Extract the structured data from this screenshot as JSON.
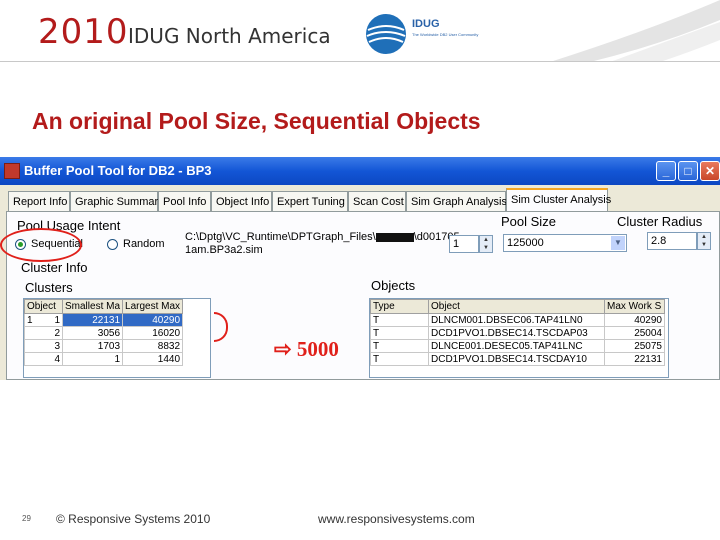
{
  "header": {
    "year": "2010",
    "conference": "IDUG North America",
    "logo_text": "IDUG",
    "logo_tagline": "The Worldwide DB2 User Community"
  },
  "slide_title": "An original Pool Size, Sequential Objects",
  "window": {
    "title": "Buffer Pool Tool for DB2 - BP3",
    "buttons": {
      "minimize": "_",
      "maximize": "□",
      "close": "✕"
    },
    "tabs": [
      {
        "label": "Report Info",
        "active": false
      },
      {
        "label": "Graphic Summary",
        "active": false
      },
      {
        "label": "Pool Info",
        "active": false
      },
      {
        "label": "Object Info",
        "active": false
      },
      {
        "label": "Expert Tuning",
        "active": false
      },
      {
        "label": "Scan Cost",
        "active": false
      },
      {
        "label": "Sim Graph Analysis",
        "active": false
      },
      {
        "label": "Sim Cluster Analysis",
        "active": true
      }
    ]
  },
  "pool_usage": {
    "heading": "Pool Usage Intent",
    "options": [
      {
        "label": "Sequential",
        "selected": true
      },
      {
        "label": "Random",
        "selected": false
      }
    ],
    "path_line1": "C:\\Dptg\\VC_Runtime\\DPTGraph_Files\\",
    "path_line1_end": "\\d001705",
    "path_line2": "1am.BP3a2.sim",
    "spin_value": "1"
  },
  "pool_size": {
    "label": "Pool Size",
    "value": "125000"
  },
  "cluster_radius": {
    "label": "Cluster Radius",
    "value": "2.8"
  },
  "cluster_info": {
    "group_label": "Cluster Info",
    "clusters_label": "Clusters"
  },
  "clusters": {
    "columns": [
      "Object",
      "Smallest Ma",
      "Largest Max"
    ],
    "rows": [
      [
        "1",
        "1",
        "22131",
        "40290"
      ],
      [
        "",
        "2",
        "3056",
        "16020"
      ],
      [
        "",
        "3",
        "1703",
        "8832"
      ],
      [
        "",
        "4",
        "1",
        "1440"
      ]
    ]
  },
  "objects": {
    "label": "Objects",
    "columns": [
      "Type",
      "Object",
      "Max Work S"
    ],
    "rows": [
      [
        "T",
        "DLNCM001.DBSEC06.TAP41LN0",
        "40290"
      ],
      [
        "T",
        "DCD1PVO1.DBSEC14.TSCDAP03",
        "25004"
      ],
      [
        "T",
        "DLNCE001.DESEC05.TAP41LNC",
        "25075"
      ],
      [
        "T",
        "DCD1PVO1.DBSEC14.TSCDAY10",
        "22131"
      ]
    ]
  },
  "annotation": {
    "note": "5000"
  },
  "footer": {
    "page": "29",
    "copyright": "© Responsive Systems 2010",
    "url": "www.responsivesystems.com"
  },
  "colors": {
    "accent_red": "#b31b1b",
    "annotation_red": "#e0201a",
    "titlebar_blue": "#1356d6"
  }
}
